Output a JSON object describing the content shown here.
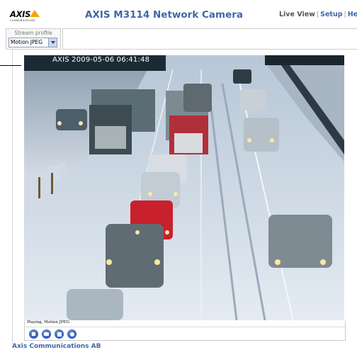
{
  "header": {
    "logo_text": "AXIS",
    "logo_subtext": "COMMUNICATIONS",
    "title": "AXIS M3114 Network Camera",
    "links": [
      {
        "label": "Live View"
      },
      {
        "label": "Setup"
      },
      {
        "label": "Help"
      }
    ],
    "separator": "|"
  },
  "stream_profile": {
    "label": "Stream profile",
    "selected": "Motion JPEG"
  },
  "video": {
    "overlay_text": "AXIS  2009-05-06 06:41:48",
    "status_text": "Playing, Motion JPEG"
  },
  "controls": [
    {
      "icon": "stop-icon"
    },
    {
      "icon": "snapshot-icon"
    },
    {
      "icon": "save-icon"
    },
    {
      "icon": "record-icon"
    }
  ],
  "footer": {
    "company": "Axis Communications AB"
  },
  "colors": {
    "accent": "#3f68a9",
    "button": "#2b56b6"
  }
}
